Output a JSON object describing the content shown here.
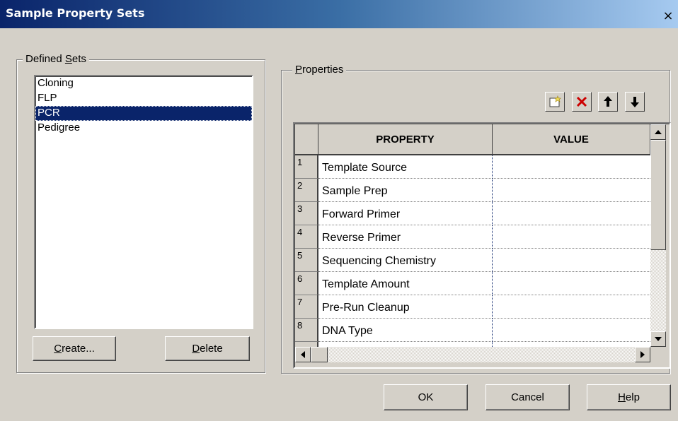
{
  "window": {
    "title": "Sample Property Sets",
    "close_label": "×"
  },
  "defined_sets": {
    "label": "Defined Sets",
    "label_mnemonic": "S",
    "items": [
      "Cloning",
      "FLP",
      "PCR",
      "Pedigree"
    ],
    "selected": "PCR",
    "create_label": "Create...",
    "delete_label": "Delete"
  },
  "properties": {
    "label": "Properties",
    "columns": [
      "PROPERTY",
      "VALUE"
    ],
    "rows": [
      {
        "num": "1",
        "property": "Template Source",
        "value": ""
      },
      {
        "num": "2",
        "property": "Sample Prep",
        "value": ""
      },
      {
        "num": "3",
        "property": "Forward Primer",
        "value": ""
      },
      {
        "num": "4",
        "property": "Reverse Primer",
        "value": ""
      },
      {
        "num": "5",
        "property": "Sequencing Chemistry",
        "value": ""
      },
      {
        "num": "6",
        "property": "Template Amount",
        "value": ""
      },
      {
        "num": "7",
        "property": "Pre-Run Cleanup",
        "value": ""
      },
      {
        "num": "8",
        "property": "DNA Type",
        "value": ""
      }
    ]
  },
  "footer": {
    "ok_label": "OK",
    "cancel_label": "Cancel",
    "help_label": "Help"
  },
  "colors": {
    "selection": "#0a246a",
    "face": "#d4d0c8",
    "delete_icon": "#cc0000"
  }
}
